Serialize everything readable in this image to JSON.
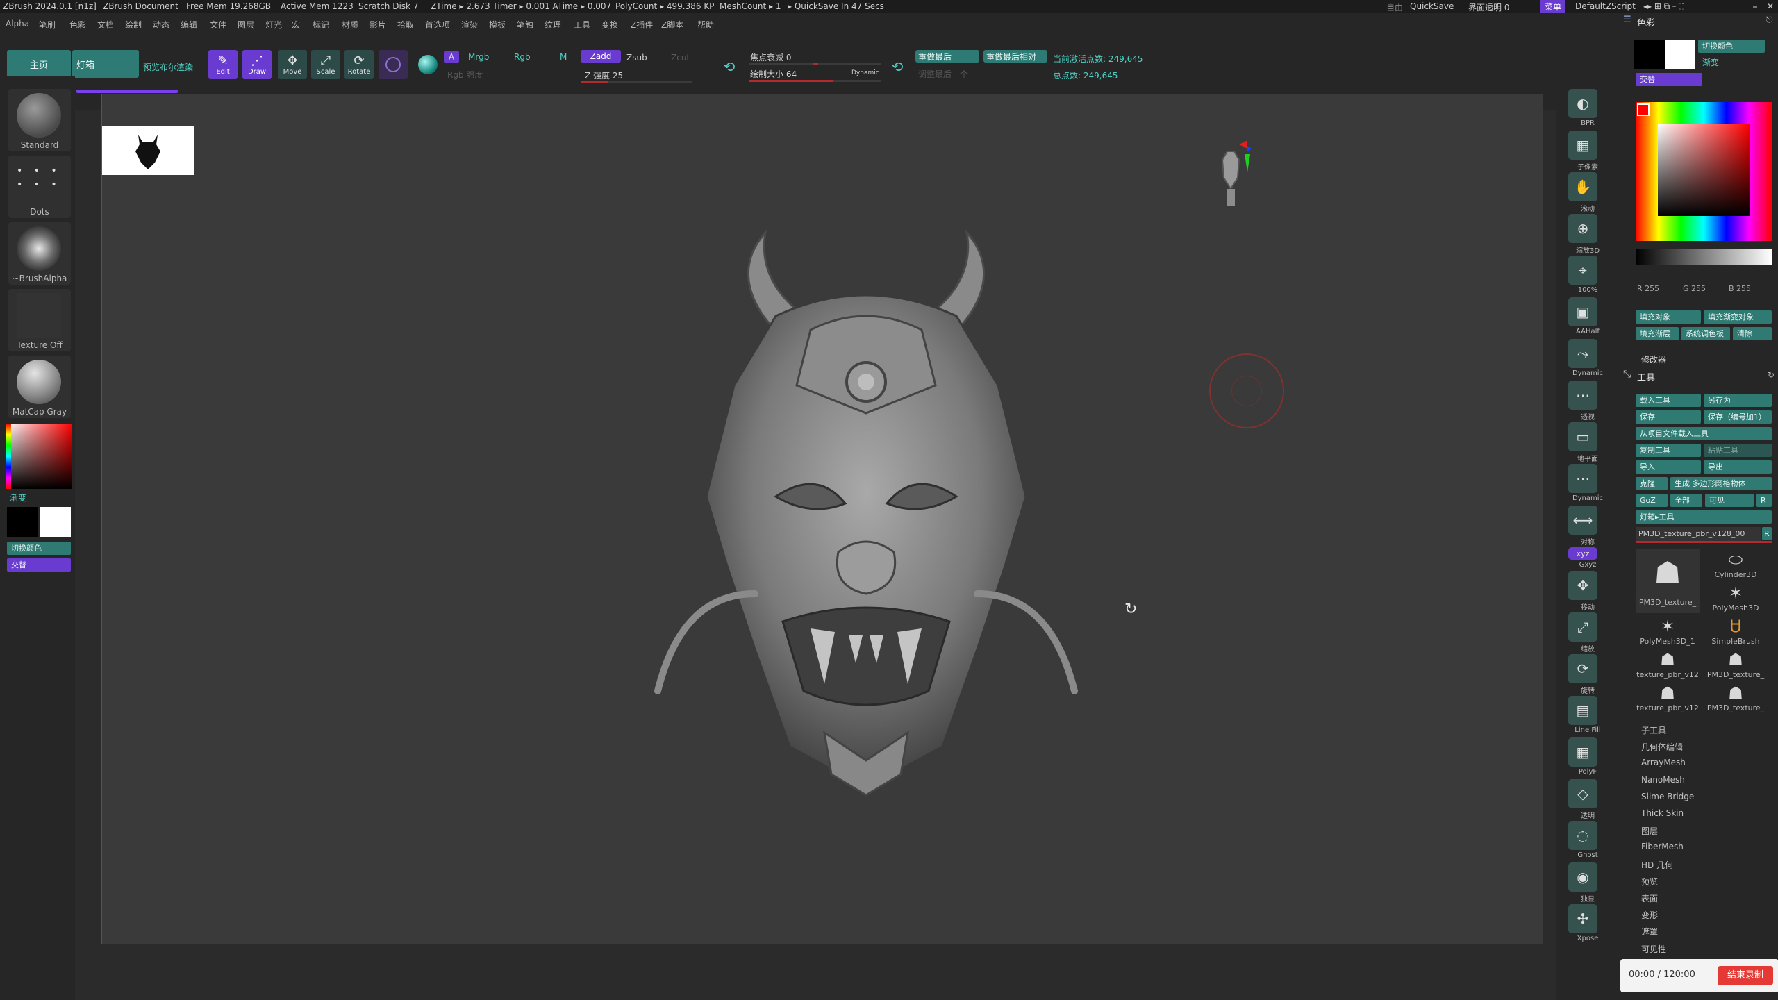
{
  "titlebar": {
    "app_title": "ZBrush 2024.0.1 [n1z]",
    "document": "ZBrush Document",
    "free_mem": "Free Mem 19.268GB",
    "active_mem": "Active Mem 1223",
    "scratch_disk": "Scratch Disk 7",
    "ztime": "ZTime ▸ 2.673 Timer ▸ 0.001 ATime ▸ 0.007",
    "polycount": "PolyCount ▸ 499.386 KP",
    "meshcount": "MeshCount ▸ 1",
    "quicksave_in": "▸ QuickSave In 47 Secs",
    "right_misc": "自由",
    "quicksave": "QuickSave",
    "ui_transparency": "界面透明 0",
    "menu_button": "菜单",
    "default_zscript": "DefaultZScript"
  },
  "menubar": [
    "Alpha",
    "笔刷",
    "色彩",
    "文档",
    "绘制",
    "动态",
    "编辑",
    "文件",
    "图层",
    "灯光",
    "宏",
    "标记",
    "材质",
    "影片",
    "拾取",
    "首选项",
    "渲染",
    "模板",
    "笔触",
    "纹理",
    "工具",
    "变换",
    "Z插件",
    "Z脚本",
    "帮助"
  ],
  "shelf": {
    "home_tab": "主页",
    "lightbox_tab": "灯箱",
    "preview_render": "预览布尔渲染",
    "edit": "Edit",
    "draw": "Draw",
    "move": "Move",
    "scale": "Scale",
    "rotate": "Rotate",
    "a_label": "A",
    "mrgb": "Mrgb",
    "rgb": "Rgb",
    "m": "M",
    "rgb_intensity": "Rgb 强度",
    "zadd": "Zadd",
    "zsub": "Zsub",
    "zcut": "Zcut",
    "z_intensity": "Z 强度 25",
    "z_intensity_value": 25,
    "focal_shift": "焦点衰减 0",
    "draw_size": "绘制大小 64",
    "draw_size_value": 64,
    "dynamic": "Dynamic",
    "replay_last": "重做最后",
    "replay_last_rel": "重做最后相对",
    "adjust_last": "调整最后一个",
    "active_points": "当前激活点数: 249,645",
    "total_points": "总点数: 249,645"
  },
  "left": {
    "brushes": [
      "Standard",
      "Dots",
      "~BrushAlpha",
      "Texture Off",
      "MatCap Gray"
    ],
    "gradient": "渐变",
    "switch_color": "切换颜色",
    "alternate": "交替"
  },
  "rstrip": [
    "BPR",
    "子像素",
    "滚动",
    "缩放3D",
    "100%",
    "AAHalf",
    "Dynamic",
    "透视",
    "地平面",
    "Dynamic",
    "对称",
    "Gxyz",
    "移动",
    "缩放",
    "旋转",
    "Line Fill",
    "PolyF",
    "透明",
    "Ghost",
    "独显",
    "Xpose"
  ],
  "rpanel": {
    "color_title": "色彩",
    "switch_color": "切换颜色",
    "gradient": "渐变",
    "alternate": "交替",
    "r": "R 255",
    "g": "G 255",
    "b": "B 255",
    "fill_object": "填充对象",
    "fill_gradient": "填充渐变对象",
    "fill_layer": "填充渐层",
    "sys_palette": "系统调色板",
    "clear": "清除",
    "modifiers": "修改器",
    "tool_title": "工具",
    "load_tool": "载入工具",
    "save_as": "另存为",
    "save": "保存",
    "save_inc": "保存（编号加1）",
    "load_from_project": "从项目文件载入工具",
    "copy_tool": "复制工具",
    "paste_tool": "粘贴工具",
    "import": "导入",
    "export": "导出",
    "clone": "克隆",
    "make_polymesh": "生成 多边形网格物体",
    "goz": "GoZ",
    "all": "全部",
    "visible": "可见",
    "r_btn": "R",
    "lightbox_tool": "灯箱▸工具",
    "current_tool": "PM3D_texture_pbr_v128_00",
    "tools": [
      "PM3D_texture_",
      "Cylinder3D",
      "PolyMesh3D",
      "PolyMesh3D_1",
      "SimpleBrush",
      "texture_pbr_v12",
      "PM3D_texture_",
      "texture_pbr_v12",
      "PM3D_texture_"
    ],
    "subpalettes": [
      "子工具",
      "几何体编辑",
      "ArrayMesh",
      "NanoMesh",
      "Slime Bridge",
      "Thick Skin",
      "图层",
      "FiberMesh",
      "HD 几何",
      "预览",
      "表面",
      "变形",
      "遮罩",
      "可见性"
    ],
    "recording_time": "00:00 / 120:00",
    "end_recording": "结束录制"
  }
}
